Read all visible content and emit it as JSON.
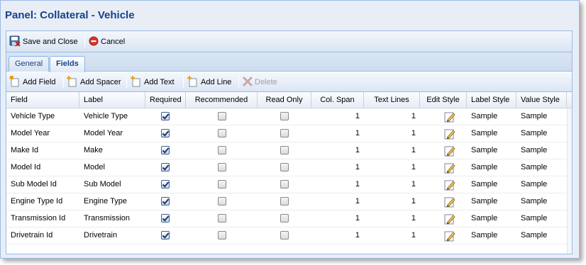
{
  "window": {
    "title": "Panel: Collateral - Vehicle"
  },
  "toolbar": {
    "save_close_label": "Save and Close",
    "cancel_label": "Cancel"
  },
  "tabs": [
    {
      "label": "General",
      "active": false
    },
    {
      "label": "Fields",
      "active": true
    }
  ],
  "subtoolbar": {
    "add_field": "Add Field",
    "add_spacer": "Add Spacer",
    "add_text": "Add Text",
    "add_line": "Add Line",
    "delete": "Delete"
  },
  "grid": {
    "columns": [
      "Field",
      "Label",
      "Required",
      "Recommended",
      "Read Only",
      "Col. Span",
      "Text Lines",
      "Edit Style",
      "Label Style",
      "Value Style"
    ],
    "rows": [
      {
        "field": "Vehicle Type",
        "label": "Vehicle Type",
        "required": true,
        "recommended": false,
        "read_only": false,
        "col_span": "1",
        "text_lines": "1",
        "label_style": "Sample",
        "value_style": "Sample"
      },
      {
        "field": "Model Year",
        "label": "Model Year",
        "required": true,
        "recommended": false,
        "read_only": false,
        "col_span": "1",
        "text_lines": "1",
        "label_style": "Sample",
        "value_style": "Sample"
      },
      {
        "field": "Make Id",
        "label": "Make",
        "required": true,
        "recommended": false,
        "read_only": false,
        "col_span": "1",
        "text_lines": "1",
        "label_style": "Sample",
        "value_style": "Sample"
      },
      {
        "field": "Model Id",
        "label": "Model",
        "required": true,
        "recommended": false,
        "read_only": false,
        "col_span": "1",
        "text_lines": "1",
        "label_style": "Sample",
        "value_style": "Sample"
      },
      {
        "field": "Sub Model Id",
        "label": "Sub Model",
        "required": true,
        "recommended": false,
        "read_only": false,
        "col_span": "1",
        "text_lines": "1",
        "label_style": "Sample",
        "value_style": "Sample"
      },
      {
        "field": "Engine Type Id",
        "label": "Engine Type",
        "required": true,
        "recommended": false,
        "read_only": false,
        "col_span": "1",
        "text_lines": "1",
        "label_style": "Sample",
        "value_style": "Sample"
      },
      {
        "field": "Transmission Id",
        "label": "Transmission",
        "required": true,
        "recommended": false,
        "read_only": false,
        "col_span": "1",
        "text_lines": "1",
        "label_style": "Sample",
        "value_style": "Sample"
      },
      {
        "field": "Drivetrain Id",
        "label": "Drivetrain",
        "required": true,
        "recommended": false,
        "read_only": false,
        "col_span": "1",
        "text_lines": "1",
        "label_style": "Sample",
        "value_style": "Sample"
      }
    ]
  },
  "colors": {
    "title": "#15428b",
    "border": "#99bbe8",
    "cancel_icon": "#d9342b",
    "add_icon": "#e8a317",
    "delete_icon_disabled": "#c9a6a6"
  },
  "icons": {
    "save_close": "save-close-icon",
    "cancel": "cancel-icon",
    "add": "add-icon",
    "delete": "delete-icon",
    "edit_style": "edit-style-icon"
  }
}
